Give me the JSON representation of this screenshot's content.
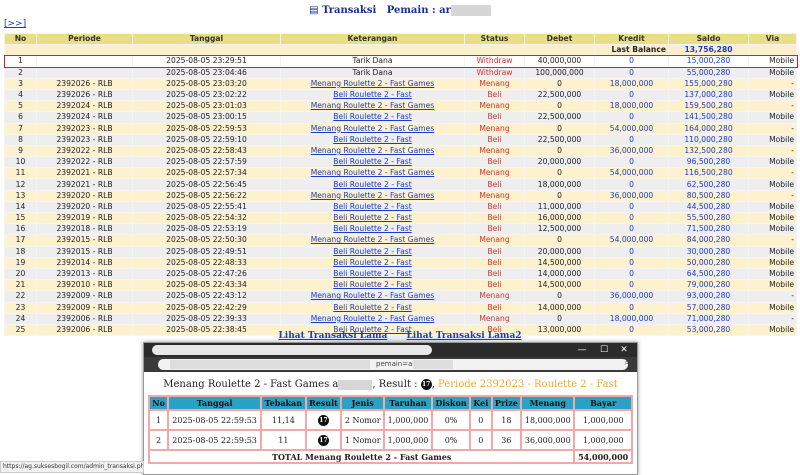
{
  "header": {
    "nav_link": "[>>]",
    "title_prefix": "Transaksi",
    "title_user": "Pemain : ar"
  },
  "columns": [
    "No",
    "Periode",
    "Tanggal",
    "Keterangan",
    "Status",
    "Debet",
    "Kredit",
    "Saldo",
    "Via"
  ],
  "last_balance": {
    "label": "Last Balance",
    "value": "13,756,280"
  },
  "rows": [
    {
      "no": "1",
      "periode": "",
      "tanggal": "2025-08-05 23:29:51",
      "ket": "Tarik Dana",
      "link": false,
      "status": "Withdraw",
      "debet": "40,000,000",
      "kredit": "0",
      "saldo": "15,000,280",
      "via": "Mobile"
    },
    {
      "no": "2",
      "periode": "",
      "tanggal": "2025-08-05 23:04:46",
      "ket": "Tarik Dana",
      "link": false,
      "status": "Withdraw",
      "debet": "100,000,000",
      "kredit": "0",
      "saldo": "55,000,280",
      "via": "Mobile"
    },
    {
      "no": "3",
      "periode": "2392026 - RLB",
      "tanggal": "2025-08-05 23:03:20",
      "ket": "Menang Roulette 2 - Fast Games",
      "link": true,
      "status": "Menang",
      "debet": "0",
      "kredit": "18,000,000",
      "saldo": "155,000,280",
      "via": "-"
    },
    {
      "no": "4",
      "periode": "2392026 - RLB",
      "tanggal": "2025-08-05 23:02:22",
      "ket": "Beli Roulette 2 - Fast",
      "link": true,
      "status": "Beli",
      "debet": "22,500,000",
      "kredit": "0",
      "saldo": "137,000,280",
      "via": "Mobile"
    },
    {
      "no": "5",
      "periode": "2392024 - RLB",
      "tanggal": "2025-08-05 23:01:03",
      "ket": "Menang Roulette 2 - Fast Games",
      "link": true,
      "status": "Menang",
      "debet": "0",
      "kredit": "18,000,000",
      "saldo": "159,500,280",
      "via": "-"
    },
    {
      "no": "6",
      "periode": "2392024 - RLB",
      "tanggal": "2025-08-05 23:00:15",
      "ket": "Beli Roulette 2 - Fast",
      "link": true,
      "status": "Beli",
      "debet": "22,500,000",
      "kredit": "0",
      "saldo": "141,500,280",
      "via": "Mobile"
    },
    {
      "no": "7",
      "periode": "2392023 - RLB",
      "tanggal": "2025-08-05 22:59:53",
      "ket": "Menang Roulette 2 - Fast Games",
      "link": true,
      "status": "Menang",
      "debet": "0",
      "kredit": "54,000,000",
      "saldo": "164,000,280",
      "via": "-"
    },
    {
      "no": "8",
      "periode": "2392023 - RLB",
      "tanggal": "2025-08-05 22:59:10",
      "ket": "Beli Roulette 2 - Fast",
      "link": true,
      "status": "Beli",
      "debet": "22,500,000",
      "kredit": "0",
      "saldo": "110,000,280",
      "via": "Mobile"
    },
    {
      "no": "9",
      "periode": "2392022 - RLB",
      "tanggal": "2025-08-05 22:58:43",
      "ket": "Menang Roulette 2 - Fast Games",
      "link": true,
      "status": "Menang",
      "debet": "0",
      "kredit": "36,000,000",
      "saldo": "132,500,280",
      "via": "-"
    },
    {
      "no": "10",
      "periode": "2392022 - RLB",
      "tanggal": "2025-08-05 22:57:59",
      "ket": "Beli Roulette 2 - Fast",
      "link": true,
      "status": "Beli",
      "debet": "20,000,000",
      "kredit": "0",
      "saldo": "96,500,280",
      "via": "Mobile"
    },
    {
      "no": "11",
      "periode": "2392021 - RLB",
      "tanggal": "2025-08-05 22:57:34",
      "ket": "Menang Roulette 2 - Fast Games",
      "link": true,
      "status": "Menang",
      "debet": "0",
      "kredit": "54,000,000",
      "saldo": "116,500,280",
      "via": "-"
    },
    {
      "no": "12",
      "periode": "2392021 - RLB",
      "tanggal": "2025-08-05 22:56:45",
      "ket": "Beli Roulette 2 - Fast",
      "link": true,
      "status": "Beli",
      "debet": "18,000,000",
      "kredit": "0",
      "saldo": "62,500,280",
      "via": "Mobile"
    },
    {
      "no": "13",
      "periode": "2392020 - RLB",
      "tanggal": "2025-08-05 22:56:22",
      "ket": "Menang Roulette 2 - Fast Games",
      "link": true,
      "status": "Menang",
      "debet": "0",
      "kredit": "36,000,000",
      "saldo": "80,500,280",
      "via": "-"
    },
    {
      "no": "14",
      "periode": "2392020 - RLB",
      "tanggal": "2025-08-05 22:55:41",
      "ket": "Beli Roulette 2 - Fast",
      "link": true,
      "status": "Beli",
      "debet": "11,000,000",
      "kredit": "0",
      "saldo": "44,500,280",
      "via": "Mobile"
    },
    {
      "no": "15",
      "periode": "2392019 - RLB",
      "tanggal": "2025-08-05 22:54:32",
      "ket": "Beli Roulette 2 - Fast",
      "link": true,
      "status": "Beli",
      "debet": "16,000,000",
      "kredit": "0",
      "saldo": "55,500,280",
      "via": "Mobile"
    },
    {
      "no": "16",
      "periode": "2392018 - RLB",
      "tanggal": "2025-08-05 22:53:19",
      "ket": "Beli Roulette 2 - Fast",
      "link": true,
      "status": "Beli",
      "debet": "12,500,000",
      "kredit": "0",
      "saldo": "71,500,280",
      "via": "Mobile"
    },
    {
      "no": "17",
      "periode": "2392015 - RLB",
      "tanggal": "2025-08-05 22:50:30",
      "ket": "Menang Roulette 2 - Fast Games",
      "link": true,
      "status": "Menang",
      "debet": "0",
      "kredit": "54,000,000",
      "saldo": "84,000,280",
      "via": "-"
    },
    {
      "no": "18",
      "periode": "2392015 - RLB",
      "tanggal": "2025-08-05 22:49:51",
      "ket": "Beli Roulette 2 - Fast",
      "link": true,
      "status": "Beli",
      "debet": "20,000,000",
      "kredit": "0",
      "saldo": "30,000,280",
      "via": "Mobile"
    },
    {
      "no": "19",
      "periode": "2392014 - RLB",
      "tanggal": "2025-08-05 22:48:33",
      "ket": "Beli Roulette 2 - Fast",
      "link": true,
      "status": "Beli",
      "debet": "14,500,000",
      "kredit": "0",
      "saldo": "50,000,280",
      "via": "Mobile"
    },
    {
      "no": "20",
      "periode": "2392013 - RLB",
      "tanggal": "2025-08-05 22:47:26",
      "ket": "Beli Roulette 2 - Fast",
      "link": true,
      "status": "Beli",
      "debet": "14,000,000",
      "kredit": "0",
      "saldo": "64,500,280",
      "via": "Mobile"
    },
    {
      "no": "21",
      "periode": "2392010 - RLB",
      "tanggal": "2025-08-05 22:43:34",
      "ket": "Beli Roulette 2 - Fast",
      "link": true,
      "status": "Beli",
      "debet": "14,500,000",
      "kredit": "0",
      "saldo": "79,000,280",
      "via": "Mobile"
    },
    {
      "no": "22",
      "periode": "2392009 - RLB",
      "tanggal": "2025-08-05 22:43:12",
      "ket": "Menang Roulette 2 - Fast Games",
      "link": true,
      "status": "Menang",
      "debet": "0",
      "kredit": "36,000,000",
      "saldo": "93,000,280",
      "via": "-"
    },
    {
      "no": "23",
      "periode": "2392009 - RLB",
      "tanggal": "2025-08-05 22:42:29",
      "ket": "Beli Roulette 2 - Fast",
      "link": true,
      "status": "Beli",
      "debet": "14,000,000",
      "kredit": "0",
      "saldo": "57,000,280",
      "via": "Mobile"
    },
    {
      "no": "24",
      "periode": "2392006 - RLB",
      "tanggal": "2025-08-05 22:39:33",
      "ket": "Menang Roulette 2 - Fast Games",
      "link": true,
      "status": "Menang",
      "debet": "0",
      "kredit": "18,000,000",
      "saldo": "71,000,280",
      "via": "-"
    },
    {
      "no": "25",
      "periode": "2392006 - RLB",
      "tanggal": "2025-08-05 22:38:45",
      "ket": "Beli Roulette 2 - Fast",
      "link": true,
      "status": "Beli",
      "debet": "13,000,000",
      "kredit": "0",
      "saldo": "53,000,280",
      "via": "Mobile"
    }
  ],
  "footer_links": [
    "Lihat Transaksi Lama",
    "Lihat Transaksi Lama2"
  ],
  "popup": {
    "address_param": "pemain=a",
    "zoom_icon": "zoom-icon",
    "title_game": "Menang Roulette 2 - Fast Games a",
    "title_result": ", Result :",
    "result_ball": "17",
    "title_period": "Periode 2392023 - Roulette 2 - Fast",
    "columns": [
      "No",
      "Tanggal",
      "Tebakan",
      "Result",
      "Jenis",
      "Taruhan",
      "Diskon",
      "Kei",
      "Prize",
      "Menang",
      "Bayar"
    ],
    "rows": [
      {
        "no": "1",
        "tanggal": "2025-08-05 22:59:53",
        "tebakan": "11,14",
        "result": "17",
        "jenis": "2 Nomor",
        "taruhan": "1,000,000",
        "diskon": "0%",
        "kei": "0",
        "prize": "18",
        "menang": "18,000,000",
        "bayar": "1,000,000"
      },
      {
        "no": "2",
        "tanggal": "2025-08-05 22:59:53",
        "tebakan": "11",
        "result": "17",
        "jenis": "1 Nomor",
        "taruhan": "1,000,000",
        "diskon": "0%",
        "kei": "0",
        "prize": "36",
        "menang": "36,000,000",
        "bayar": "1,000,000"
      }
    ],
    "total_label": "TOTAL Menang Roulette 2 - Fast Games",
    "total_value": "54,000,000"
  },
  "statusbar": "https://ag.suksesbogil.com/admin_transaksi.php?p",
  "colors": {
    "header_bg": "#e9de86",
    "link": "#1a3cc8",
    "status": "#d83131",
    "highlight_border": "#c8262b",
    "popup_header": "#29a2c6"
  }
}
